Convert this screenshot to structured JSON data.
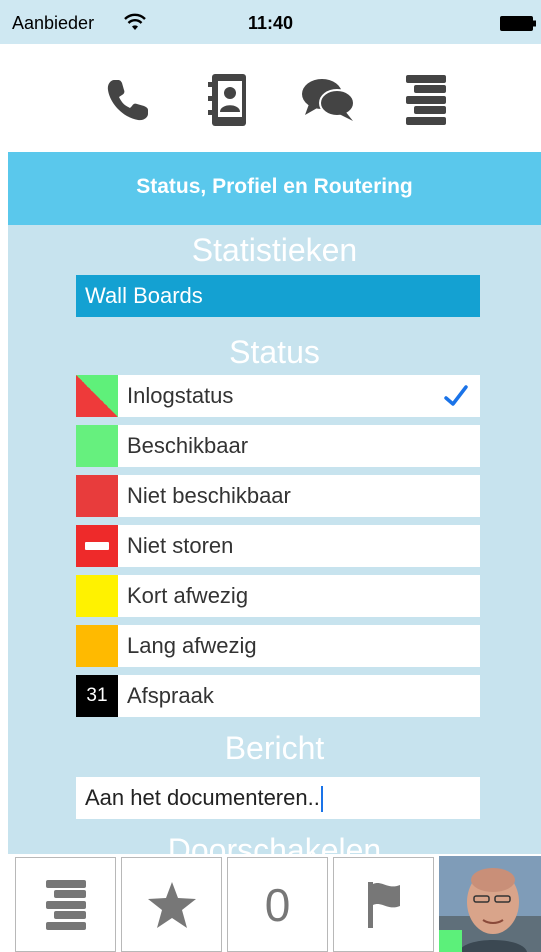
{
  "statusbar": {
    "carrier": "Aanbieder",
    "time": "11:40"
  },
  "topnav": {
    "icons": [
      "phone-icon",
      "contacts-icon",
      "chat-icon",
      "menu-icon"
    ]
  },
  "header": {
    "title": "Status, Profiel en Routering"
  },
  "statistics": {
    "title": "Statistieken",
    "wallboards_label": "Wall Boards"
  },
  "status": {
    "title": "Status",
    "items": [
      {
        "label": "Inlogstatus",
        "swatch": "half",
        "checked": true
      },
      {
        "label": "Beschikbaar",
        "swatch": "green",
        "color": "#66f07e"
      },
      {
        "label": "Niet beschikbaar",
        "swatch": "red",
        "color": "#e83c3c"
      },
      {
        "label": "Niet storen",
        "swatch": "dnd",
        "color": "#ee2a2a"
      },
      {
        "label": "Kort afwezig",
        "swatch": "yellow",
        "color": "#fff200"
      },
      {
        "label": "Lang afwezig",
        "swatch": "orange",
        "color": "#ffba00"
      },
      {
        "label": "Afspraak",
        "swatch": "calendar",
        "calendar_day": "31"
      }
    ]
  },
  "message": {
    "title": "Bericht",
    "value": "Aan het documenteren.."
  },
  "forwarding": {
    "title": "Doorschakelen"
  },
  "toolbar": {
    "count": "0",
    "icons": [
      "menu-icon",
      "star-icon",
      "flag-icon"
    ]
  },
  "colors": {
    "accent": "#5ac8ec",
    "background": "#c7e3ee",
    "wallboards": "#14a1d2",
    "check": "#1a73e8"
  }
}
